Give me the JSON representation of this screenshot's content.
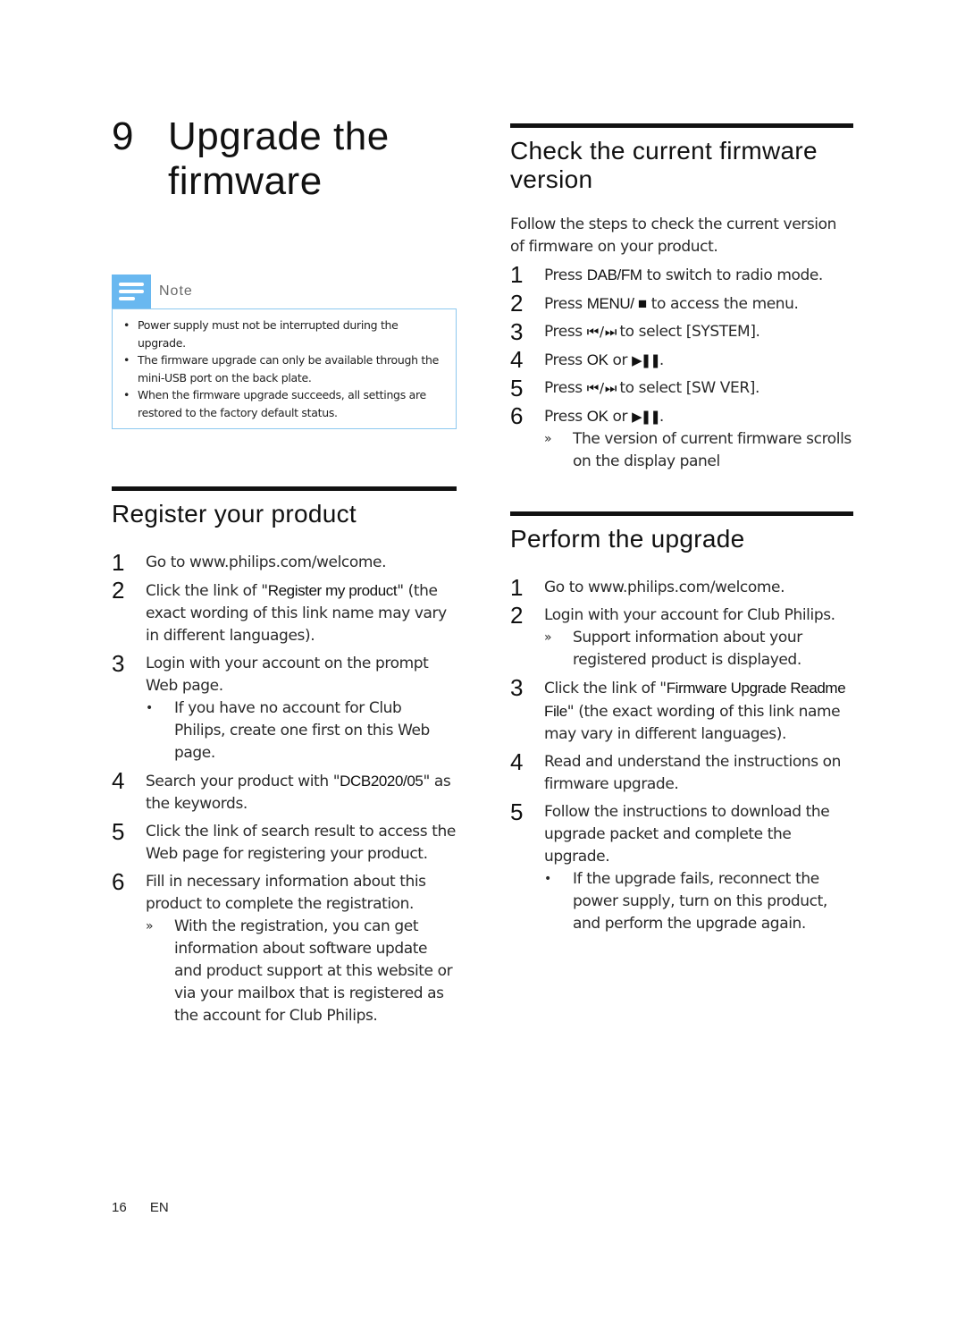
{
  "chapter": {
    "number": "9",
    "title": "Upgrade the firmware"
  },
  "note": {
    "icon": "note-lines-icon",
    "label": "Note",
    "items": [
      "Power supply must not be interrupted during the upgrade.",
      "The firmware upgrade can only be available through the mini-USB port on the back plate.",
      "When the firmware upgrade succeeds, all settings are restored to the factory default status."
    ]
  },
  "register": {
    "title": "Register your product",
    "steps": [
      {
        "num": "1",
        "text": "Go to www.philips.com/welcome."
      },
      {
        "num": "2",
        "pre": "Click the link of \"",
        "strong": "Register my product",
        "post": "\" (the exact wording of this link name may vary in different languages)."
      },
      {
        "num": "3",
        "text": "Login with your account on the prompt Web page.",
        "sub": {
          "mark": "•",
          "text": "If you have no account for Club Philips, create one first on this Web page."
        }
      },
      {
        "num": "4",
        "pre": "Search your product with \"",
        "strong": "DCB2020/05",
        "post": "\" as the keywords."
      },
      {
        "num": "5",
        "text": "Click the link of search result to access the Web page for registering your product."
      },
      {
        "num": "6",
        "text": "Fill in necessary information about this product to complete the registration.",
        "sub": {
          "mark": "»",
          "text": "With the registration, you can get information about software update and product support at this website or via your mailbox that is registered as the account for Club Philips."
        }
      }
    ]
  },
  "check": {
    "title": "Check the current firmware version",
    "intro": "Follow the steps to check the current version of firmware on your product.",
    "steps": [
      {
        "num": "1",
        "pre": "Press ",
        "strong": "DAB/FM",
        "post": " to switch to radio mode."
      },
      {
        "num": "2",
        "pre": "Press ",
        "strong": "MENU/ ■",
        "post": " to access the menu."
      },
      {
        "num": "3",
        "pre": "Press ",
        "strong": "⏮ / ⏭",
        "post": " to select [SYSTEM]."
      },
      {
        "num": "4",
        "pre": "Press ",
        "strong": "OK",
        "mid": " or ",
        "strong2": "▶❚❚",
        "post": "."
      },
      {
        "num": "5",
        "pre": "Press ",
        "strong": "⏮ / ⏭",
        "post": " to select [SW VER]."
      },
      {
        "num": "6",
        "pre": "Press ",
        "strong": "OK",
        "mid": " or ",
        "strong2": "▶❚❚",
        "post": ".",
        "sub": {
          "mark": "»",
          "text": "The version of current firmware scrolls on the display panel"
        }
      }
    ]
  },
  "perform": {
    "title": "Perform the upgrade",
    "steps": [
      {
        "num": "1",
        "text": "Go to www.philips.com/welcome."
      },
      {
        "num": "2",
        "text": "Login with your account for Club Philips.",
        "sub": {
          "mark": "»",
          "text": "Support information about your registered product is displayed."
        }
      },
      {
        "num": "3",
        "pre": "Click the link of \"",
        "strong": "Firmware Upgrade Readme File",
        "post": "\" (the exact wording of this link name may vary in different languages)."
      },
      {
        "num": "4",
        "text": "Read and understand the instructions on firmware upgrade."
      },
      {
        "num": "5",
        "text": "Follow the instructions to download the upgrade packet and complete the upgrade.",
        "sub": {
          "mark": "•",
          "text": "If the upgrade fails, reconnect the power supply, turn on this product, and perform the upgrade again."
        }
      }
    ]
  },
  "footer": {
    "page": "16",
    "lang": "EN"
  }
}
